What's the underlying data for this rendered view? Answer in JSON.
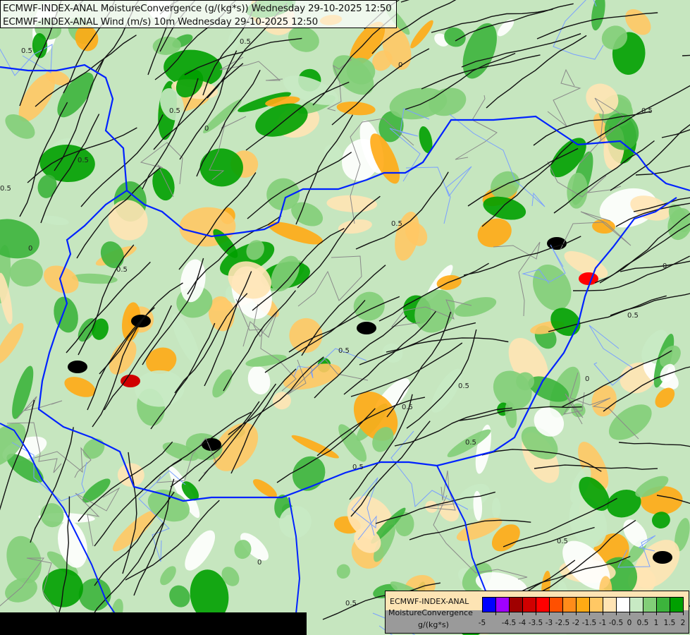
{
  "header": {
    "line1": "ECMWF-INDEX-ANAL MoistureConvergence (g/(kg*s)) Wednesday 29-10-2025 12:50",
    "line2": "ECMWF-INDEX-ANAL Wind (m/s) 10m Wednesday 29-10-2025 12:50"
  },
  "legend": {
    "model": "ECMWF-INDEX-ANAL",
    "parameter": "MoistureConvergence",
    "unit": "g/(kg*s)",
    "ticks": [
      "-5",
      "-4.5",
      "-4",
      "-3.5",
      "-3",
      "-2.5",
      "-2",
      "-1.5",
      "-1",
      "-0.5",
      "0",
      "0.5",
      "1",
      "1.5",
      "2"
    ],
    "colors": [
      "#0000ff",
      "#a000ff",
      "#a00000",
      "#d00000",
      "#ff0000",
      "#ff5000",
      "#ff8c1a",
      "#ffaa14",
      "#ffc864",
      "#ffe4b4",
      "#ffffff",
      "#c8eac4",
      "#82ce78",
      "#3cb43c",
      "#00a000"
    ]
  },
  "map": {
    "contour_labels": [
      "0.5",
      "0",
      "0.5",
      "0.5",
      "0",
      "0.5",
      "0.5",
      "0",
      "0.5",
      "0.5",
      "0.5",
      "0",
      "0.5",
      "0.5",
      "0",
      "0.5",
      "0.5",
      "0.5",
      "0.5",
      "0",
      "0.5",
      "0.5"
    ],
    "colors": {
      "border": "#0022ff",
      "river": "#7aa0ff",
      "streamline": "#111111",
      "admin": "#8a8a8a"
    }
  }
}
